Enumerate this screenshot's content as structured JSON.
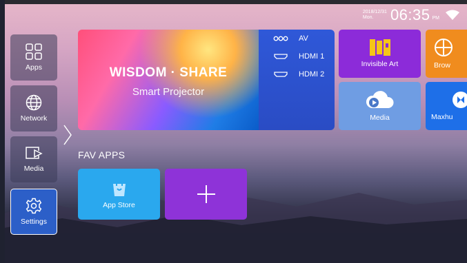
{
  "status": {
    "date": "2018/12/31",
    "weekday": "Mon.",
    "time": "06:35",
    "ampm": "PM"
  },
  "sidebar": {
    "items": [
      {
        "label": "Apps",
        "icon": "apps-grid-icon"
      },
      {
        "label": "Network",
        "icon": "globe-icon"
      },
      {
        "label": "Media",
        "icon": "media-play-icon"
      },
      {
        "label": "Settings",
        "icon": "gear-icon",
        "selected": true
      }
    ]
  },
  "hero": {
    "title": "WISDOM · SHARE",
    "subtitle": "Smart Projector"
  },
  "inputs": [
    {
      "label": "AV",
      "icon": "av-icon"
    },
    {
      "label": "HDMI 1",
      "icon": "hdmi-icon"
    },
    {
      "label": "HDMI 2",
      "icon": "hdmi-icon"
    }
  ],
  "tiles": {
    "invisible_art": {
      "label": "Invisible Art",
      "color": "#8c2bd9"
    },
    "browser": {
      "label": "Brow",
      "color": "#f08c1e"
    },
    "media": {
      "label": "Media",
      "color": "#6f9de3"
    },
    "maxhub": {
      "label": "Maxhu",
      "color": "#1e6fe8"
    }
  },
  "fav": {
    "title": "FAV APPS",
    "items": [
      {
        "label": "App Store",
        "color": "#2aa8ee"
      },
      {
        "label": "",
        "color": "#8e33d8",
        "icon": "plus-icon"
      }
    ]
  }
}
